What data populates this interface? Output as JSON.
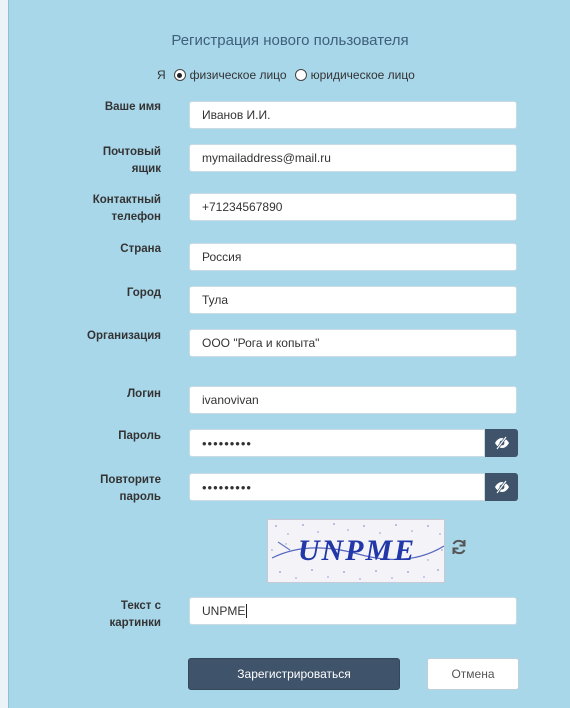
{
  "form": {
    "title": "Регистрация нового пользователя",
    "person_type": {
      "prefix": "Я",
      "options": [
        "физическое лицо",
        "юридическое лицо"
      ],
      "selected": "физическое лицо"
    },
    "fields": {
      "name": {
        "label": "Ваше имя",
        "value": "Иванов И.И."
      },
      "email": {
        "label_line1": "Почтовый",
        "label_line2": "ящик",
        "value": "mymailaddress@mail.ru"
      },
      "phone": {
        "label_line1": "Контактный",
        "label_line2": "телефон",
        "value": "+71234567890"
      },
      "country": {
        "label": "Страна",
        "value": "Россия"
      },
      "city": {
        "label": "Город",
        "value": "Тула"
      },
      "organization": {
        "label": "Организация",
        "value": "ООО \"Рога и копыта\""
      },
      "login": {
        "label": "Логин",
        "value": "ivanovivan"
      },
      "password": {
        "label": "Пароль",
        "value": "•••••••••"
      },
      "password_repeat": {
        "label_line1": "Повторите",
        "label_line2": "пароль",
        "value": "•••••••••"
      },
      "captcha_text": {
        "label_line1": "Текст с",
        "label_line2": "картинки",
        "value": "UNPME"
      }
    },
    "captcha_image_text": "UNPME",
    "icons": {
      "eye": "eye-slash-icon",
      "refresh": "refresh-icon"
    },
    "buttons": {
      "register": "Зарегистрироваться",
      "cancel": "Отмена"
    },
    "colors": {
      "panel_bg": "#a9d7ea",
      "primary_button": "#3f536a",
      "title": "#3f5f7a"
    }
  }
}
